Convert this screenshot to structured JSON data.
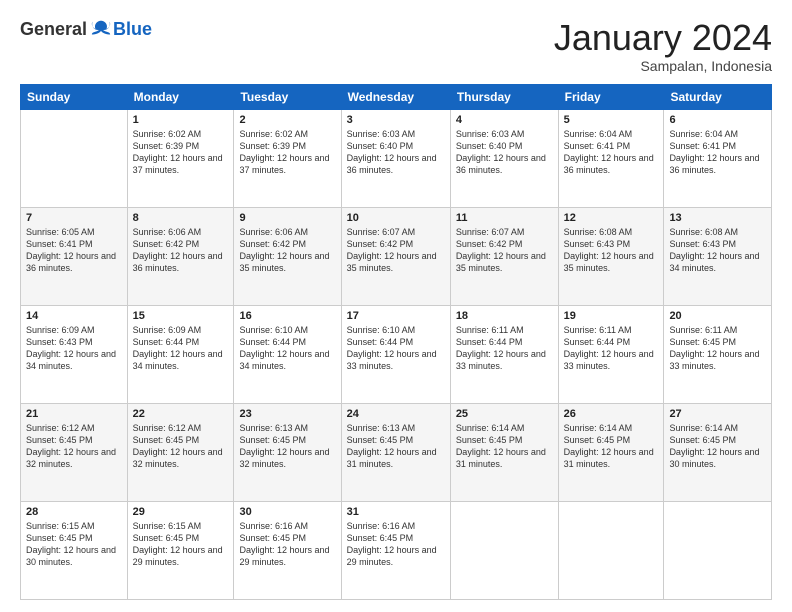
{
  "header": {
    "logo_general": "General",
    "logo_blue": "Blue",
    "month_title": "January 2024",
    "subtitle": "Sampalan, Indonesia"
  },
  "days_of_week": [
    "Sunday",
    "Monday",
    "Tuesday",
    "Wednesday",
    "Thursday",
    "Friday",
    "Saturday"
  ],
  "weeks": [
    [
      {
        "day": null,
        "sunrise": null,
        "sunset": null,
        "daylight": null
      },
      {
        "day": "1",
        "sunrise": "6:02 AM",
        "sunset": "6:39 PM",
        "daylight": "12 hours and 37 minutes."
      },
      {
        "day": "2",
        "sunrise": "6:02 AM",
        "sunset": "6:39 PM",
        "daylight": "12 hours and 37 minutes."
      },
      {
        "day": "3",
        "sunrise": "6:03 AM",
        "sunset": "6:40 PM",
        "daylight": "12 hours and 36 minutes."
      },
      {
        "day": "4",
        "sunrise": "6:03 AM",
        "sunset": "6:40 PM",
        "daylight": "12 hours and 36 minutes."
      },
      {
        "day": "5",
        "sunrise": "6:04 AM",
        "sunset": "6:41 PM",
        "daylight": "12 hours and 36 minutes."
      },
      {
        "day": "6",
        "sunrise": "6:04 AM",
        "sunset": "6:41 PM",
        "daylight": "12 hours and 36 minutes."
      }
    ],
    [
      {
        "day": "7",
        "sunrise": "6:05 AM",
        "sunset": "6:41 PM",
        "daylight": "12 hours and 36 minutes."
      },
      {
        "day": "8",
        "sunrise": "6:06 AM",
        "sunset": "6:42 PM",
        "daylight": "12 hours and 36 minutes."
      },
      {
        "day": "9",
        "sunrise": "6:06 AM",
        "sunset": "6:42 PM",
        "daylight": "12 hours and 35 minutes."
      },
      {
        "day": "10",
        "sunrise": "6:07 AM",
        "sunset": "6:42 PM",
        "daylight": "12 hours and 35 minutes."
      },
      {
        "day": "11",
        "sunrise": "6:07 AM",
        "sunset": "6:42 PM",
        "daylight": "12 hours and 35 minutes."
      },
      {
        "day": "12",
        "sunrise": "6:08 AM",
        "sunset": "6:43 PM",
        "daylight": "12 hours and 35 minutes."
      },
      {
        "day": "13",
        "sunrise": "6:08 AM",
        "sunset": "6:43 PM",
        "daylight": "12 hours and 34 minutes."
      }
    ],
    [
      {
        "day": "14",
        "sunrise": "6:09 AM",
        "sunset": "6:43 PM",
        "daylight": "12 hours and 34 minutes."
      },
      {
        "day": "15",
        "sunrise": "6:09 AM",
        "sunset": "6:44 PM",
        "daylight": "12 hours and 34 minutes."
      },
      {
        "day": "16",
        "sunrise": "6:10 AM",
        "sunset": "6:44 PM",
        "daylight": "12 hours and 34 minutes."
      },
      {
        "day": "17",
        "sunrise": "6:10 AM",
        "sunset": "6:44 PM",
        "daylight": "12 hours and 33 minutes."
      },
      {
        "day": "18",
        "sunrise": "6:11 AM",
        "sunset": "6:44 PM",
        "daylight": "12 hours and 33 minutes."
      },
      {
        "day": "19",
        "sunrise": "6:11 AM",
        "sunset": "6:44 PM",
        "daylight": "12 hours and 33 minutes."
      },
      {
        "day": "20",
        "sunrise": "6:11 AM",
        "sunset": "6:45 PM",
        "daylight": "12 hours and 33 minutes."
      }
    ],
    [
      {
        "day": "21",
        "sunrise": "6:12 AM",
        "sunset": "6:45 PM",
        "daylight": "12 hours and 32 minutes."
      },
      {
        "day": "22",
        "sunrise": "6:12 AM",
        "sunset": "6:45 PM",
        "daylight": "12 hours and 32 minutes."
      },
      {
        "day": "23",
        "sunrise": "6:13 AM",
        "sunset": "6:45 PM",
        "daylight": "12 hours and 32 minutes."
      },
      {
        "day": "24",
        "sunrise": "6:13 AM",
        "sunset": "6:45 PM",
        "daylight": "12 hours and 31 minutes."
      },
      {
        "day": "25",
        "sunrise": "6:14 AM",
        "sunset": "6:45 PM",
        "daylight": "12 hours and 31 minutes."
      },
      {
        "day": "26",
        "sunrise": "6:14 AM",
        "sunset": "6:45 PM",
        "daylight": "12 hours and 31 minutes."
      },
      {
        "day": "27",
        "sunrise": "6:14 AM",
        "sunset": "6:45 PM",
        "daylight": "12 hours and 30 minutes."
      }
    ],
    [
      {
        "day": "28",
        "sunrise": "6:15 AM",
        "sunset": "6:45 PM",
        "daylight": "12 hours and 30 minutes."
      },
      {
        "day": "29",
        "sunrise": "6:15 AM",
        "sunset": "6:45 PM",
        "daylight": "12 hours and 29 minutes."
      },
      {
        "day": "30",
        "sunrise": "6:16 AM",
        "sunset": "6:45 PM",
        "daylight": "12 hours and 29 minutes."
      },
      {
        "day": "31",
        "sunrise": "6:16 AM",
        "sunset": "6:45 PM",
        "daylight": "12 hours and 29 minutes."
      },
      {
        "day": null,
        "sunrise": null,
        "sunset": null,
        "daylight": null
      },
      {
        "day": null,
        "sunrise": null,
        "sunset": null,
        "daylight": null
      },
      {
        "day": null,
        "sunrise": null,
        "sunset": null,
        "daylight": null
      }
    ]
  ]
}
